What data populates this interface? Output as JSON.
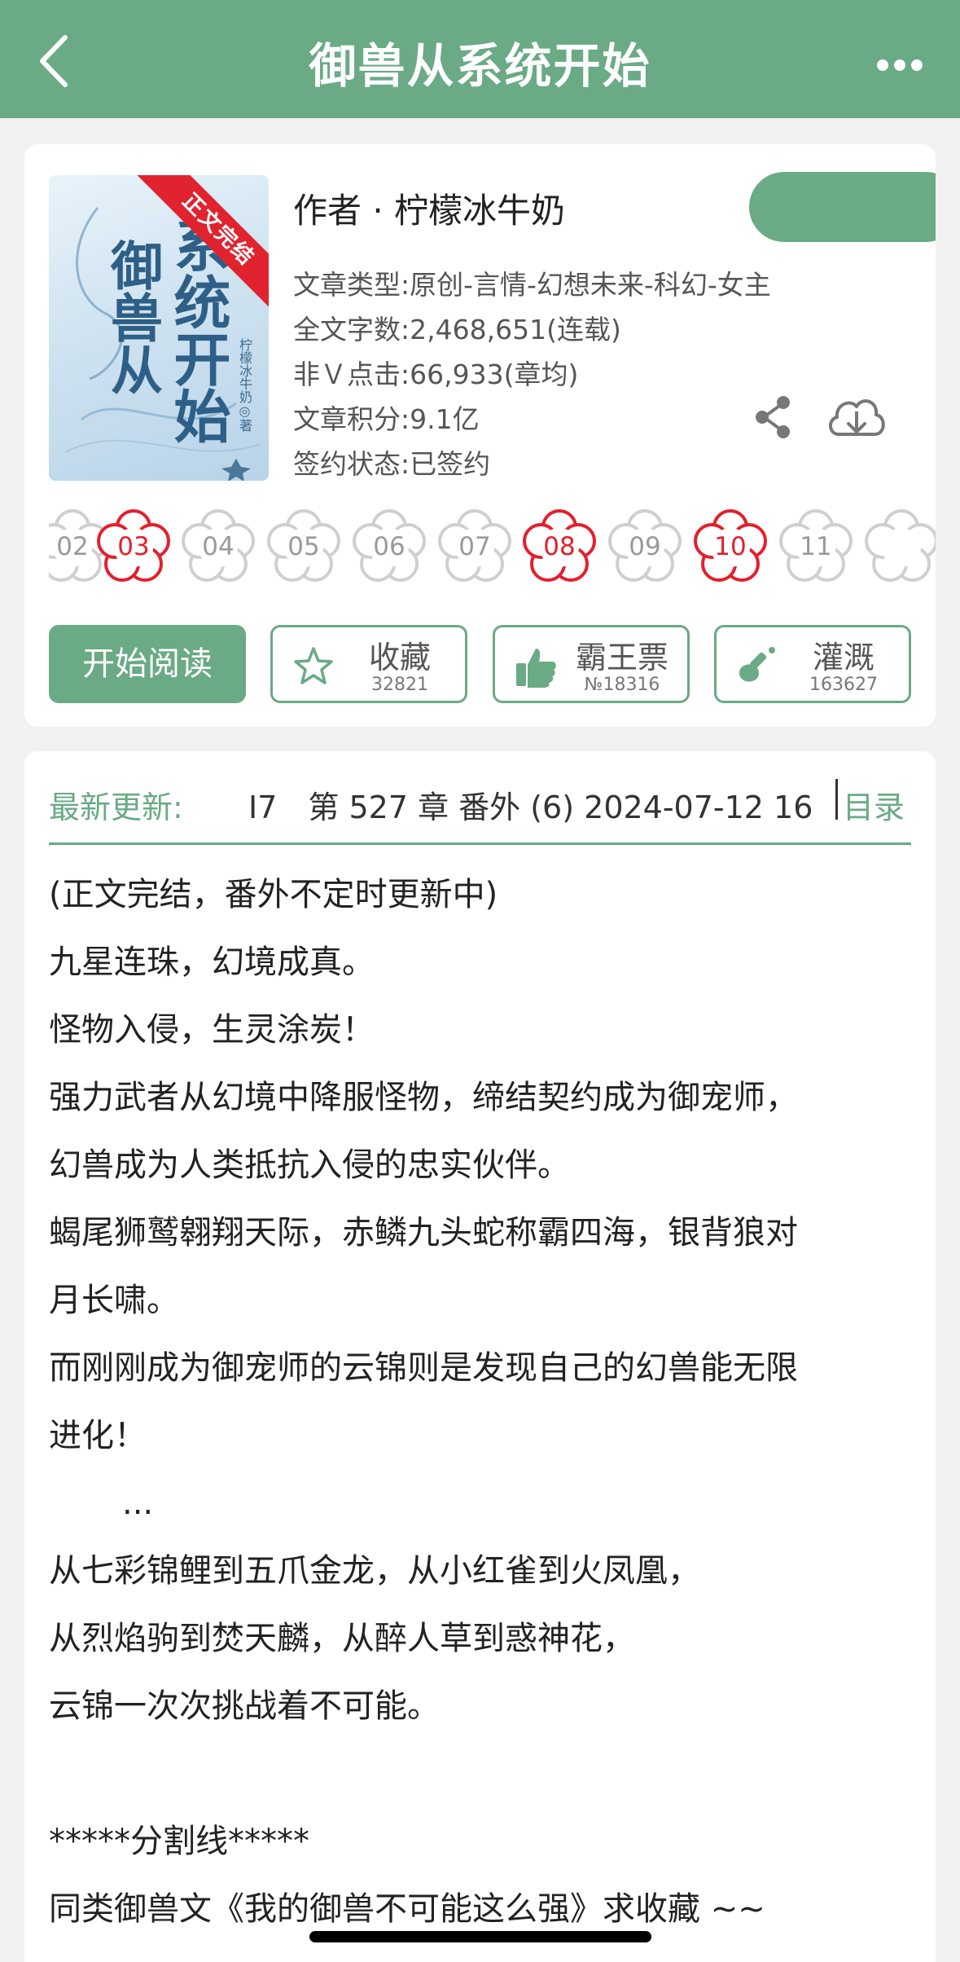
{
  "header": {
    "title": "御兽从系统开始",
    "back_icon": "chevron-left-icon",
    "more_icon": "more-dots-icon",
    "color": "#6aaa84"
  },
  "book": {
    "cover": {
      "ribbon": "正文完结",
      "title_col1": "御兽从",
      "title_col2": "系统开始",
      "author_line": "柠檬冰牛奶◎著"
    },
    "author": "作者 · 柠檬冰牛奶",
    "type": "文章类型:原创-言情-幻想未来-科幻-女主",
    "word_count": "全文字数:2,468,651(连载)",
    "clicks": "非Ｖ点击:66,933(章均)",
    "score": "文章积分:9.1亿",
    "sign_status": "签约状态:已签约"
  },
  "flowers": [
    {
      "label": "02",
      "highlight": false
    },
    {
      "label": "03",
      "highlight": true
    },
    {
      "label": "04",
      "highlight": false
    },
    {
      "label": "05",
      "highlight": false
    },
    {
      "label": "06",
      "highlight": false
    },
    {
      "label": "07",
      "highlight": false
    },
    {
      "label": "08",
      "highlight": true
    },
    {
      "label": "09",
      "highlight": false
    },
    {
      "label": "10",
      "highlight": true
    },
    {
      "label": "11",
      "highlight": false
    }
  ],
  "actions": {
    "read": "开始阅读",
    "favorite": {
      "label": "收藏",
      "count": "32821"
    },
    "ticket": {
      "label": "霸王票",
      "count": "№18316"
    },
    "water": {
      "label": "灌溉",
      "count": "163627"
    }
  },
  "update": {
    "label": "最新更新:",
    "value": "I7　第 527 章 番外 (6) 2024-07-12 16",
    "toc": "目录"
  },
  "description": [
    "(正文完结，番外不定时更新中)",
    "九星连珠，幻境成真。",
    "怪物入侵，生灵涂炭！",
    "强力武者从幻境中降服怪物，缔结契约成为御宠师，",
    "幻兽成为人类抵抗入侵的忠实伙伴。",
    "蝎尾狮鹫翱翔天际，赤鳞九头蛇称霸四海，银背狼对",
    "月长啸。",
    "而刚刚成为御宠师的云锦则是发现自己的幻兽能无限",
    "进化！",
    "...",
    "从七彩锦鲤到五爪金龙，从小红雀到火凤凰，",
    "从烈焰驹到焚天麟，从醉人草到惑神花，",
    "云锦一次次挑战着不可能。",
    "",
    "*****分割线*****",
    "同类御兽文《我的御兽不可能这么强》求收藏 ~~"
  ]
}
